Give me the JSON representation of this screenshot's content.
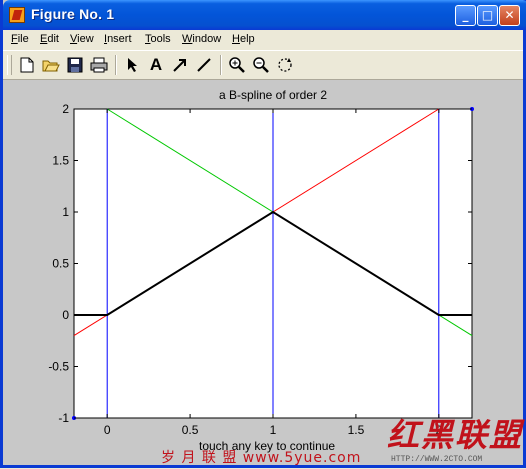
{
  "window": {
    "title": "Figure No. 1",
    "minimize_label": "_",
    "maximize_label": "□",
    "close_label": "✕"
  },
  "menubar": {
    "items": [
      {
        "label": "File",
        "key": "F",
        "rest": "ile"
      },
      {
        "label": "Edit",
        "key": "E",
        "rest": "dit"
      },
      {
        "label": "View",
        "key": "V",
        "rest": "iew"
      },
      {
        "label": "Insert",
        "key": "I",
        "rest": "nsert"
      },
      {
        "label": "Tools",
        "key": "T",
        "rest": "ools"
      },
      {
        "label": "Window",
        "key": "W",
        "rest": "indow"
      },
      {
        "label": "Help",
        "key": "H",
        "rest": "elp"
      }
    ]
  },
  "toolbar": {
    "tools": [
      "new-file-icon",
      "open-folder-icon",
      "save-icon",
      "print-icon",
      "pointer-arrow-icon",
      "text-insert-icon",
      "arrow-insert-icon",
      "line-insert-icon",
      "zoom-in-icon",
      "zoom-out-icon",
      "rotate-icon"
    ],
    "text_tool_label": "A"
  },
  "figure": {
    "footer_text": "touch any key to continue",
    "watermark_left": "岁 月 联 盟  www.5yue.com",
    "watermark_right": "红黑联盟",
    "watermark_url": "HTTP://WWW.2CTO.COM"
  },
  "chart_data": {
    "type": "line",
    "title": "a B-spline of order 2",
    "xlabel": "",
    "ylabel": "",
    "xlim": [
      -0.2,
      2.2
    ],
    "ylim": [
      -1,
      2
    ],
    "x_ticks": [
      "0",
      "0.5",
      "1",
      "1.5",
      "2"
    ],
    "x_tick_values": [
      0,
      0.5,
      1,
      1.5,
      2
    ],
    "y_ticks": [
      "-1",
      "-0.5",
      "0",
      "0.5",
      "1",
      "1.5",
      "2"
    ],
    "y_tick_values": [
      -1,
      -0.5,
      0,
      0.5,
      1,
      1.5,
      2
    ],
    "grid": false,
    "series": [
      {
        "color": "#ff0000",
        "x": [
          -0.2,
          2.0
        ],
        "y": [
          -0.2,
          2.0
        ]
      },
      {
        "color": "#00c800",
        "x": [
          0.0,
          2.2
        ],
        "y": [
          2.0,
          -0.2
        ]
      },
      {
        "color": "#0000ff",
        "x": [
          0,
          0
        ],
        "y": [
          -1,
          2
        ]
      },
      {
        "color": "#0000ff",
        "x": [
          1,
          1
        ],
        "y": [
          -1,
          2
        ]
      },
      {
        "color": "#0000ff",
        "x": [
          2,
          2
        ],
        "y": [
          -1,
          2
        ]
      },
      {
        "color": "#000000",
        "x": [
          -0.2,
          0,
          1,
          2,
          2.2
        ],
        "y": [
          0,
          0,
          1,
          0,
          0
        ]
      }
    ],
    "marker_points": [
      {
        "color": "#0000ff",
        "x": -0.2,
        "y": -1
      },
      {
        "color": "#0000ff",
        "x": 2.2,
        "y": 2
      }
    ]
  }
}
